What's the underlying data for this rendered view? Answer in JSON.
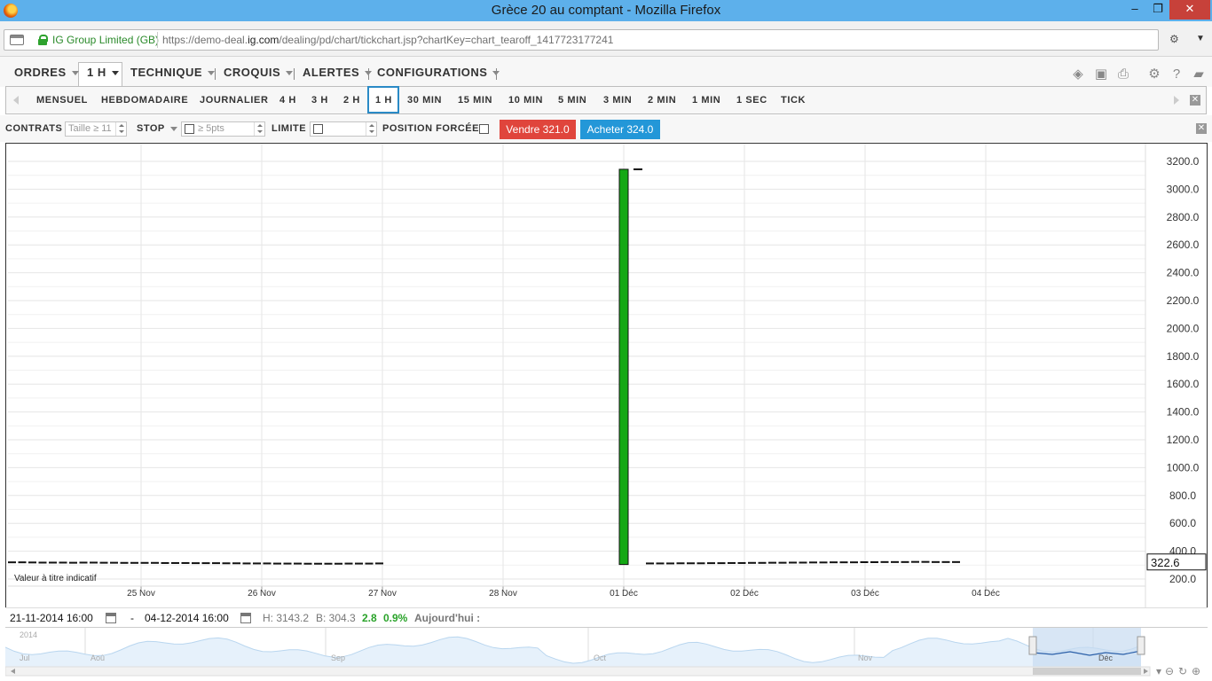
{
  "window": {
    "title": "Grèce 20 au comptant - Mozilla Firefox",
    "min": "–",
    "max": "❐",
    "close": "✕"
  },
  "address": {
    "identity": "IG Group Limited (GB)",
    "url_prefix": "https://demo-deal.",
    "url_domain": "ig.com",
    "url_suffix": "/dealing/pd/chart/tickchart.jsp?chartKey=chart_tearoff_1417723177241"
  },
  "menu": {
    "orders": "ORDRES",
    "timeframe": "1 H",
    "technical": "TECHNIQUE",
    "sketches": "CROQUIS",
    "alerts": "ALERTES",
    "configurations": "CONFIGURATIONS"
  },
  "timeframes": [
    "MENSUEL",
    "HEBDOMADAIRE",
    "JOURNALIER",
    "4 H",
    "3 H",
    "2 H",
    "1 H",
    "30 MIN",
    "15 MIN",
    "10 MIN",
    "5 MIN",
    "3 MIN",
    "2 MIN",
    "1 MIN",
    "1 SEC",
    "TICK"
  ],
  "selected_timeframe": "1 H",
  "deal": {
    "contracts_label": "CONTRATS",
    "contracts_placeholder": "Taille ≥ 11",
    "stop_label": "STOP",
    "stop_placeholder": "≥ 5pts",
    "limit_label": "LIMITE",
    "limit_value": "",
    "forced_label": "POSITION FORCÉE",
    "sell_label": "Vendre 321.0",
    "buy_label": "Acheter 324.0",
    "sell_color": "#e0453c",
    "buy_color": "#2397d8"
  },
  "chart_data": {
    "type": "bar",
    "indicative_note": "Valeur à titre indicatif",
    "current_value": "322.6",
    "y_ticks": [
      "3200.0",
      "3000.0",
      "2800.0",
      "2600.0",
      "2400.0",
      "2200.0",
      "2000.0",
      "1800.0",
      "1600.0",
      "1400.0",
      "1200.0",
      "1000.0",
      "800.0",
      "600.0",
      "400.0",
      "200.0"
    ],
    "ylim": [
      200,
      3200
    ],
    "x_ticks": [
      "25 Nov",
      "26 Nov",
      "27 Nov",
      "28 Nov",
      "01 Déc",
      "02 Déc",
      "03 Déc",
      "04 Déc"
    ],
    "spike_bar": {
      "open": 304.3,
      "close": 3143.2,
      "color": "#14a814"
    },
    "spike_after": 3143.2,
    "baseline_before": [
      320,
      320,
      319,
      318,
      318,
      318,
      317,
      318,
      318,
      317,
      317,
      316,
      316,
      316,
      316,
      315,
      315,
      315,
      314,
      314,
      314,
      313,
      313,
      312,
      312,
      312,
      311,
      311,
      311,
      310,
      310,
      310,
      310,
      311,
      311,
      311,
      312
    ],
    "baseline_after": [
      312,
      312,
      312,
      313,
      313,
      313,
      314,
      314,
      315,
      315,
      316,
      316,
      317,
      317,
      318,
      318,
      319,
      319,
      320,
      320,
      320,
      321,
      321,
      322,
      322,
      322,
      323,
      323,
      322,
      322,
      322
    ]
  },
  "info": {
    "from": "21-11-2014 16:00",
    "dash": "-",
    "to": "04-12-2014 16:00",
    "high": "H: 3143.2",
    "low": "B: 304.3",
    "change": "2.8",
    "change_pct": "0.9%",
    "today": "Aujourd'hui :"
  },
  "navigator": {
    "year": "2014",
    "months": [
      "Jul",
      "Aoû",
      "Sep",
      "Oct",
      "Nov",
      "Déc"
    ]
  }
}
